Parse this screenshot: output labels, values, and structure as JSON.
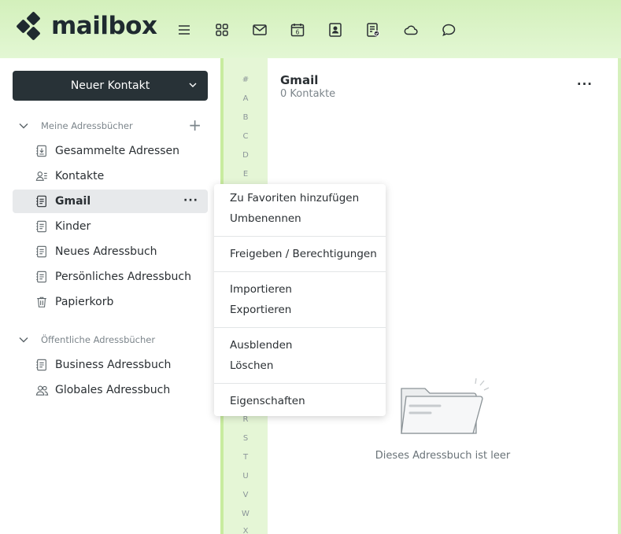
{
  "brand": {
    "name": "mailbox",
    "color": "#1f2a30",
    "accent": "#c8ec9f"
  },
  "topnav": [
    "menu-icon",
    "apps-grid-icon",
    "mail-icon",
    "calendar-icon",
    "contacts-icon",
    "tasks-icon",
    "cloud-icon",
    "chat-icon"
  ],
  "calendar_day": "6",
  "sidebar": {
    "new_contact_label": "Neuer Kontakt",
    "section_mine": "Meine Adressbücher",
    "section_public": "Öffentliche Adressbücher",
    "mine_items": [
      {
        "label": "Gesammelte Adressen",
        "icon": "collected-addresses-icon"
      },
      {
        "label": "Kontakte",
        "icon": "contacts-list-icon"
      },
      {
        "label": "Gmail",
        "icon": "addressbook-icon",
        "active": true
      },
      {
        "label": "Kinder",
        "icon": "addressbook-icon"
      },
      {
        "label": "Neues Adressbuch",
        "icon": "addressbook-icon"
      },
      {
        "label": "Persönliches Adressbuch",
        "icon": "addressbook-icon"
      },
      {
        "label": "Papierkorb",
        "icon": "trash-icon"
      }
    ],
    "public_items": [
      {
        "label": "Business Adressbuch",
        "icon": "addressbook-icon"
      },
      {
        "label": "Globales Adressbuch",
        "icon": "group-icon"
      }
    ],
    "more_glyph": "···"
  },
  "alphabet": [
    "#",
    "A",
    "B",
    "C",
    "D",
    "E",
    "R",
    "S",
    "T",
    "U",
    "V",
    "W",
    "X"
  ],
  "main": {
    "title": "Gmail",
    "subtitle": "0 Kontakte",
    "more_glyph": "···",
    "empty_text": "Dieses Adressbuch ist leer"
  },
  "context_menu": {
    "add_favorite": "Zu Favoriten hinzufügen",
    "rename": "Umbenennen",
    "share": "Freigeben / Berechtigungen",
    "import": "Importieren",
    "export": "Exportieren",
    "hide": "Ausblenden",
    "delete": "Löschen",
    "properties": "Eigenschaften"
  }
}
